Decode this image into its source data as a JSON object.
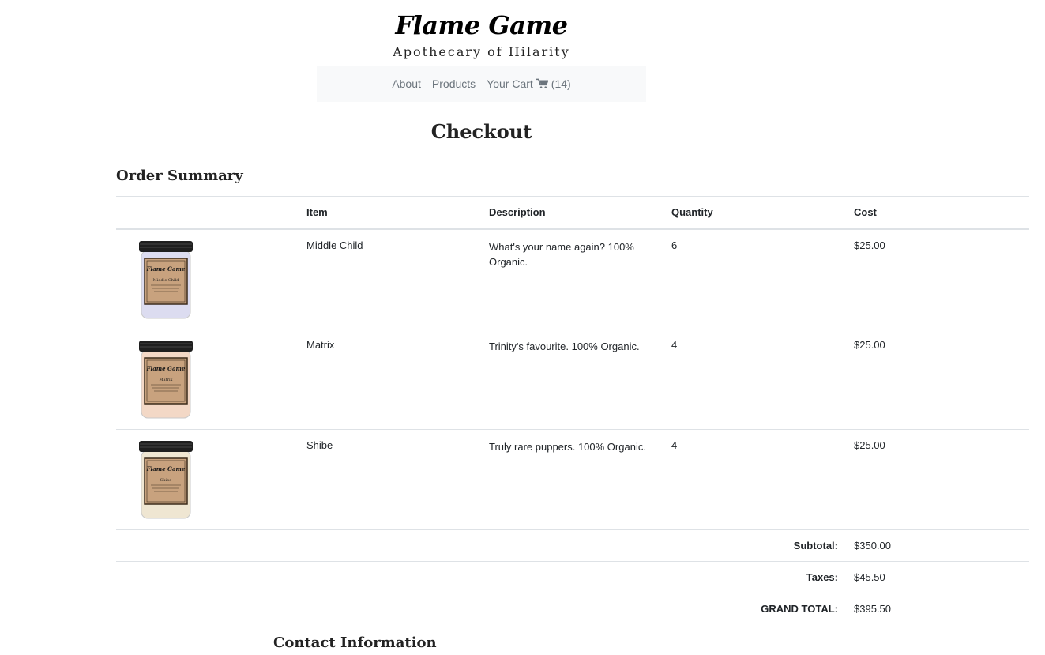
{
  "brand": {
    "name": "Flame Game",
    "tagline": "Apothecary of Hilarity"
  },
  "nav": {
    "about": "About",
    "products": "Products",
    "cart_label": "Your Cart",
    "cart_count": "(14)"
  },
  "page": {
    "title": "Checkout"
  },
  "order_summary": {
    "title": "Order Summary",
    "headers": {
      "item": "Item",
      "description": "Description",
      "quantity": "Quantity",
      "cost": "Cost"
    },
    "items": [
      {
        "item": "Middle Child",
        "description": "What's your name again? 100% Organic.",
        "quantity": "6",
        "cost": "$25.00",
        "jar_color": "#dcdcf0",
        "label_text": "Middle Child"
      },
      {
        "item": "Matrix",
        "description": "Trinity's favourite. 100% Organic.",
        "quantity": "4",
        "cost": "$25.00",
        "jar_color": "#f3d8c6",
        "label_text": "Matrix"
      },
      {
        "item": "Shibe",
        "description": "Truly rare puppers. 100% Organic.",
        "quantity": "4",
        "cost": "$25.00",
        "jar_color": "#efe6d2",
        "label_text": "Shibe"
      }
    ],
    "subtotal_label": "Subtotal:",
    "subtotal": "$350.00",
    "taxes_label": "Taxes:",
    "taxes": "$45.50",
    "grand_total_label": "GRAND TOTAL:",
    "grand_total": "$395.50"
  },
  "contact": {
    "title": "Contact Information"
  }
}
